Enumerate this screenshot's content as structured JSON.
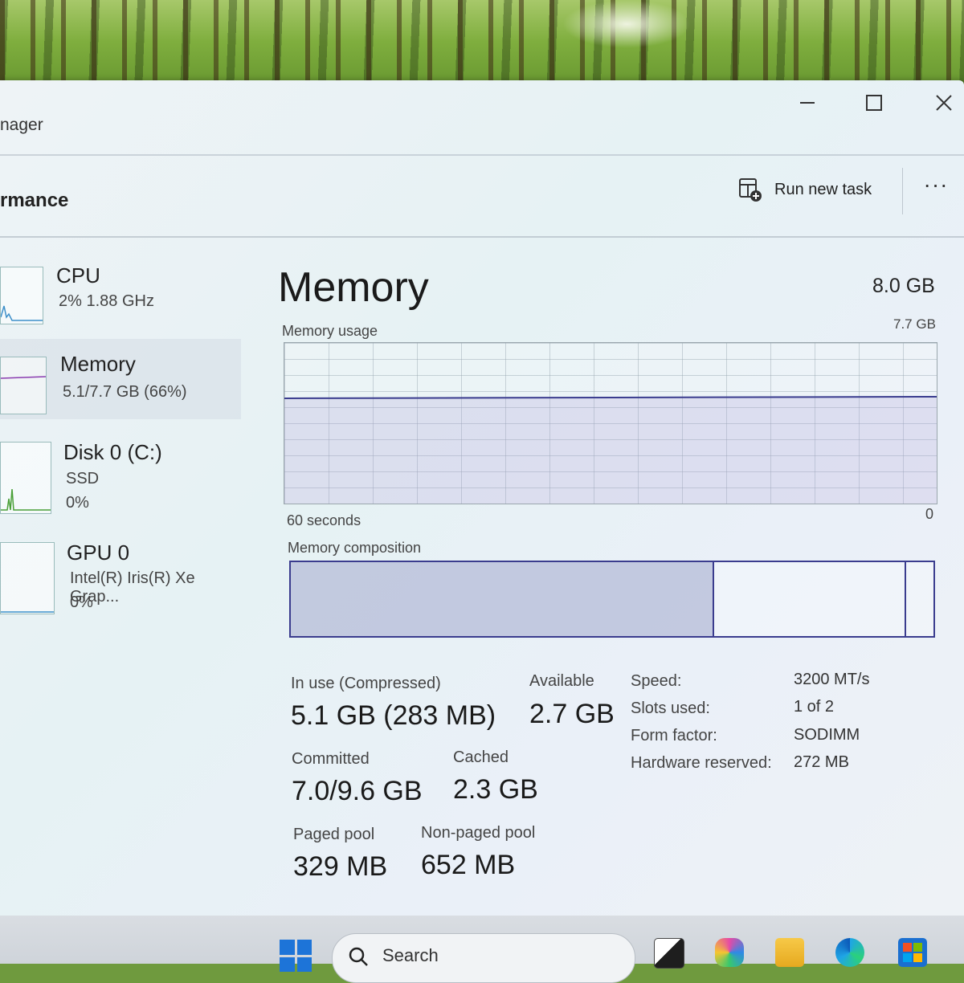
{
  "window": {
    "title": "nager",
    "controls": {
      "minimize": "minimize-icon",
      "maximize": "maximize-icon",
      "close": "close-icon"
    }
  },
  "header": {
    "page_title": "rmance",
    "run_task_label": "Run new task",
    "more_label": "···"
  },
  "sidebar": {
    "items": [
      {
        "name": "CPU",
        "line1": "2%  1.88 GHz",
        "line2": ""
      },
      {
        "name": "Memory",
        "line1": "5.1/7.7 GB (66%)",
        "line2": ""
      },
      {
        "name": "Disk 0 (C:)",
        "line1": "SSD",
        "line2": "0%"
      },
      {
        "name": "GPU 0",
        "line1": "Intel(R) Iris(R) Xe Grap...",
        "line2": "0%"
      }
    ]
  },
  "main": {
    "title": "Memory",
    "total": "8.0 GB",
    "usage_label": "Memory usage",
    "usage_max": "7.7 GB",
    "x_left": "60 seconds",
    "x_right": "0",
    "composition_label": "Memory composition",
    "composition": {
      "in_use_fraction": 0.66,
      "modified_fraction": 0.02,
      "standby_fraction": 0.3
    },
    "usage_fraction": 0.66,
    "stats": {
      "in_use_label": "In use (Compressed)",
      "in_use_value": "5.1 GB (283 MB)",
      "available_label": "Available",
      "available_value": "2.7 GB",
      "committed_label": "Committed",
      "committed_value": "7.0/9.6 GB",
      "cached_label": "Cached",
      "cached_value": "2.3 GB",
      "paged_label": "Paged pool",
      "paged_value": "329 MB",
      "nonpaged_label": "Non-paged pool",
      "nonpaged_value": "652 MB"
    },
    "details": [
      {
        "label": "Speed:",
        "value": "3200 MT/s"
      },
      {
        "label": "Slots used:",
        "value": "1 of 2"
      },
      {
        "label": "Form factor:",
        "value": "SODIMM"
      },
      {
        "label": "Hardware reserved:",
        "value": "272 MB"
      }
    ]
  },
  "taskbar": {
    "search_placeholder": "Search",
    "icons": [
      "windows-start-icon",
      "search-icon",
      "task-view-icon",
      "copilot-icon",
      "file-explorer-icon",
      "edge-icon",
      "store-icon"
    ]
  }
}
